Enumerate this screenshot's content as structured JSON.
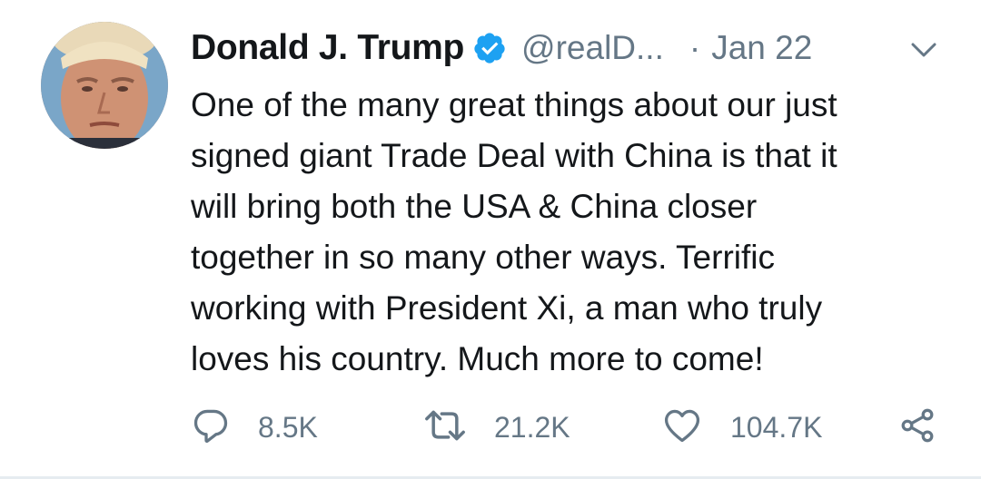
{
  "tweet": {
    "display_name": "Donald J. Trump",
    "handle": "@realD...",
    "separator": "·",
    "date": "Jan 22",
    "text_lines": [
      "One of the many great things about our just",
      "signed giant Trade Deal with China is that it",
      "will bring both the USA & China closer",
      "together in so many other ways. Terrific",
      "working with President Xi, a man who truly",
      "loves his country. Much more to come!"
    ],
    "actions": {
      "reply_count": "8.5K",
      "retweet_count": "21.2K",
      "like_count": "104.7K"
    }
  },
  "icons": {
    "verified": "verified-badge-icon",
    "menu": "chevron-down-icon",
    "reply": "reply-icon",
    "retweet": "retweet-icon",
    "like": "heart-icon",
    "share": "share-icon"
  },
  "colors": {
    "text_primary": "#14171a",
    "text_secondary": "#657786",
    "verified_blue": "#1da1f2",
    "divider": "#e6ecf0"
  }
}
